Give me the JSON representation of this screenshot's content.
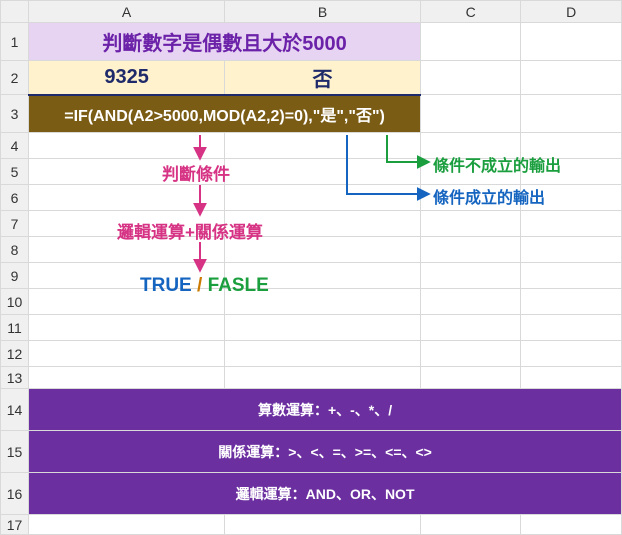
{
  "columns": [
    "A",
    "B",
    "C",
    "D"
  ],
  "rows": [
    "1",
    "2",
    "3",
    "4",
    "5",
    "6",
    "7",
    "8",
    "9",
    "10",
    "11",
    "12",
    "13",
    "14",
    "15",
    "16",
    "17"
  ],
  "r1": {
    "title": "判斷數字是偶數且大於5000"
  },
  "r2": {
    "value": "9325",
    "result": "否"
  },
  "r3": {
    "formula": "=IF(AND(A2>5000,MOD(A2,2)=0),\"是\",\"否\")"
  },
  "annotations": {
    "condition": "判斷條件",
    "logic_relation": "邏輯運算+關係運算",
    "output_false": "條件不成立的輸出",
    "output_true": "條件成立的輸出",
    "true_label": "TRUE",
    "sep": " / ",
    "false_label": "FASLE"
  },
  "operators": {
    "arithmetic": "算數運算：+、-、*、/",
    "relational": "關係運算：>、<、=、>=、<=、<>",
    "logical": "邏輯運算：AND、OR、NOT"
  }
}
